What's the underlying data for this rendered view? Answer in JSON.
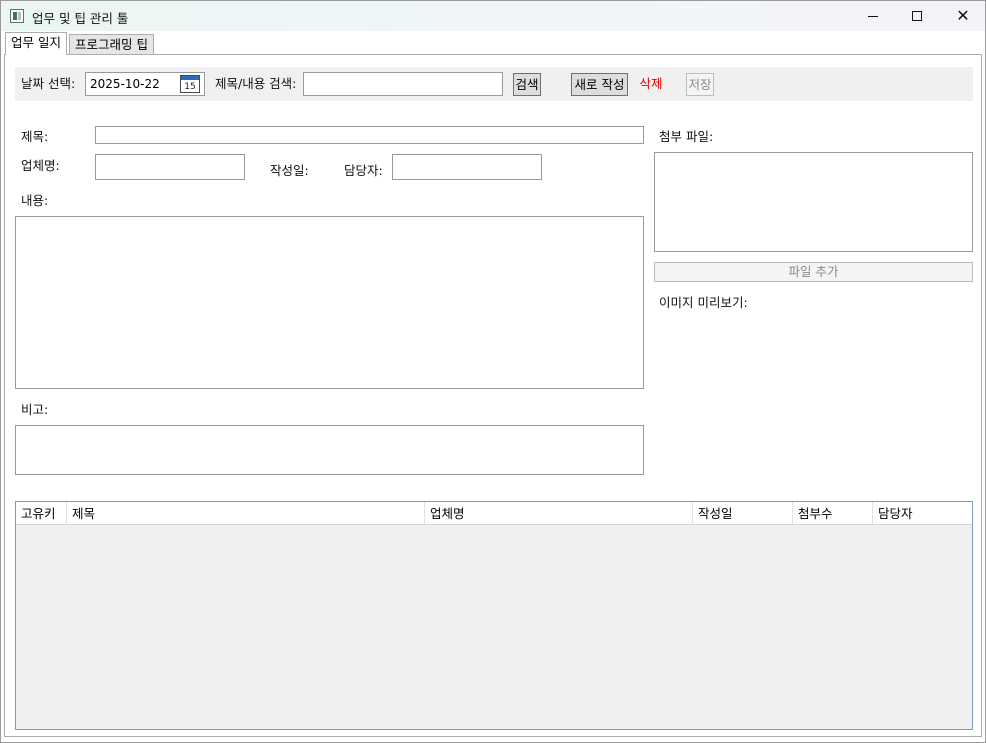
{
  "window": {
    "title": "업무 및 팁 관리 툴"
  },
  "tabs": [
    {
      "label": "업무 일지"
    },
    {
      "label": "프로그래밍 팁"
    }
  ],
  "toolbar": {
    "date_label": "날짜 선택:",
    "date_value": "2025-10-22",
    "calendar_day": "15",
    "search_label": "제목/내용 검색:",
    "search_value": "",
    "search_button": "검색",
    "new_button": "새로 작성",
    "delete_button": "삭제",
    "save_button": "저장"
  },
  "form": {
    "title_label": "제목:",
    "title_value": "",
    "company_label": "업체명:",
    "company_value": "",
    "date_label": "작성일:",
    "manager_label": "담당자:",
    "manager_value": "",
    "content_label": "내용:",
    "content_value": "",
    "note_label": "비고:",
    "note_value": ""
  },
  "attachments": {
    "label": "첨부 파일:",
    "add_button": "파일 추가",
    "preview_label": "이미지 미리보기:"
  },
  "grid": {
    "columns": [
      "고유키",
      "제목",
      "업체명",
      "작성일",
      "첨부수",
      "담당자"
    ],
    "rows": []
  },
  "colors": {
    "delete": "#e00000",
    "disabled": "#8a8a8a",
    "grid_border": "#7a9cc6"
  }
}
